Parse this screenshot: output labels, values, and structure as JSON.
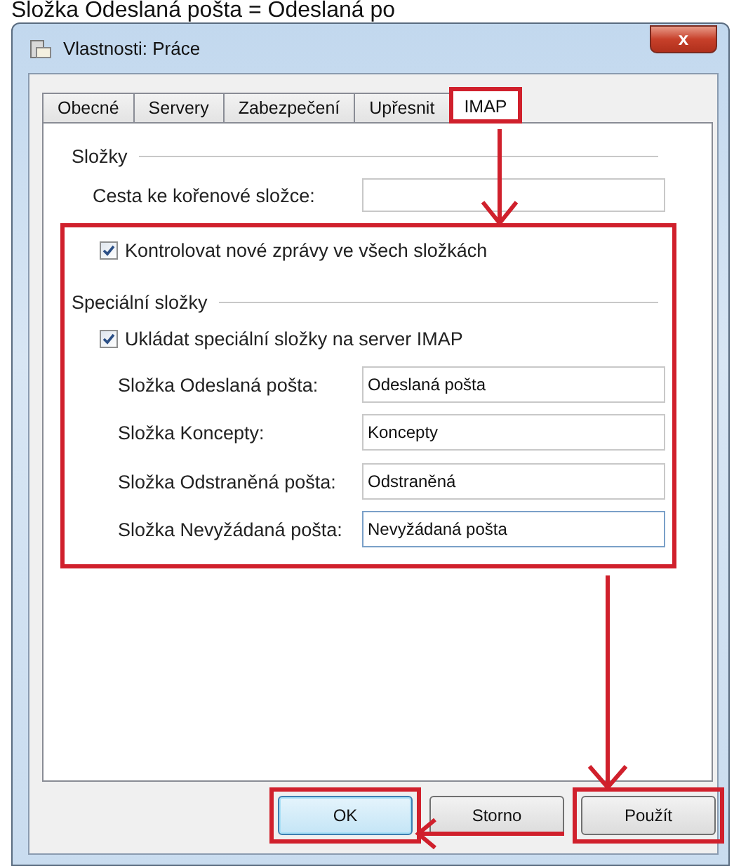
{
  "caption": "Složka Odeslaná pošta = Odeslaná po",
  "window": {
    "title": "Vlastnosti: Práce",
    "close": "x"
  },
  "tabs": [
    {
      "label": "Obecné",
      "selected": false,
      "highlighted": false
    },
    {
      "label": "Servery",
      "selected": false,
      "highlighted": false
    },
    {
      "label": "Zabezpečení",
      "selected": false,
      "highlighted": false
    },
    {
      "label": "Upřesnit",
      "selected": false,
      "highlighted": false
    },
    {
      "label": "IMAP",
      "selected": true,
      "highlighted": true
    }
  ],
  "folders": {
    "legend": "Složky",
    "root_path_label": "Cesta ke kořenové složce:"
  },
  "check_new": {
    "label": "Kontrolovat nové zprávy ve všech složkách",
    "checked": true
  },
  "special": {
    "legend": "Speciální složky",
    "highlighted": true,
    "store": {
      "label": "Ukládat speciální složky na server IMAP",
      "checked": true
    },
    "rows": [
      {
        "label": "Složka Odeslaná pošta:",
        "value": "Odeslaná pošta"
      },
      {
        "label": "Složka Koncepty:",
        "value": "Koncepty"
      },
      {
        "label": "Složka Odstraněná pošta:",
        "value": "Odstraněná"
      },
      {
        "label": "Složka Nevyžádaná pošta:",
        "value": "Nevyžádaná pošta"
      }
    ]
  },
  "buttons": [
    {
      "label": "OK",
      "default": true,
      "highlighted": true
    },
    {
      "label": "Storno",
      "default": false,
      "highlighted": false
    },
    {
      "label": "Použít",
      "default": false,
      "highlighted": true
    }
  ]
}
